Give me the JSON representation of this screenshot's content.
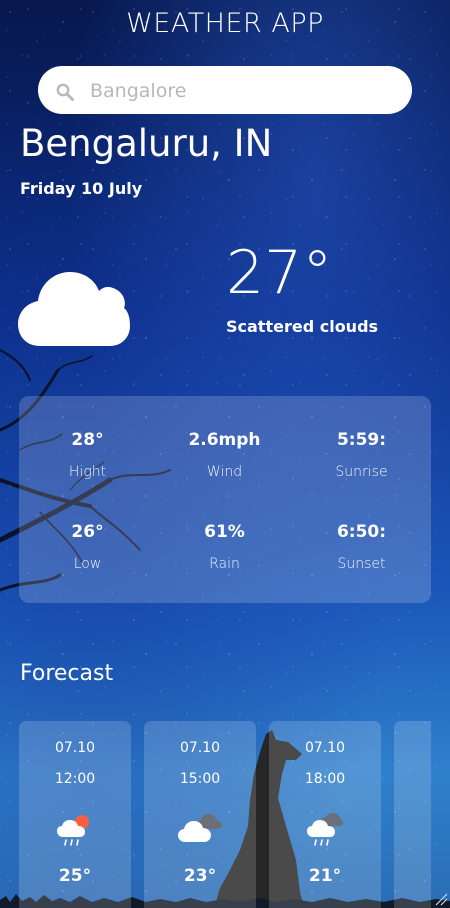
{
  "app": {
    "title": "WEATHER APP"
  },
  "search": {
    "placeholder": "Bangalore",
    "icon": "search-icon"
  },
  "location": {
    "city": "Bengaluru, IN",
    "date": "Friday 10 July"
  },
  "current": {
    "temperature": "27°",
    "description": "Scattered clouds",
    "icon": "cloud-icon"
  },
  "stats": [
    {
      "value": "28°",
      "label": "Hight"
    },
    {
      "value": "2.6mph",
      "label": "Wind"
    },
    {
      "value": "5:59:",
      "label": "Sunrise"
    },
    {
      "value": "26°",
      "label": "Low"
    },
    {
      "value": "61%",
      "label": "Rain"
    },
    {
      "value": "6:50:",
      "label": "Sunset"
    }
  ],
  "forecast": {
    "title": "Forecast",
    "items": [
      {
        "date": "07.10",
        "time": "12:00",
        "temp": "25°",
        "icon": "sun-cloud-rain-icon"
      },
      {
        "date": "07.10",
        "time": "15:00",
        "temp": "23°",
        "icon": "broken-clouds-icon"
      },
      {
        "date": "07.10",
        "time": "18:00",
        "temp": "21°",
        "icon": "cloud-rain-icon"
      }
    ]
  },
  "colors": {
    "accent_sun": "#f5613f",
    "card_bg": "rgba(255,255,255,0.18)",
    "search_bg": "#ffffff"
  }
}
